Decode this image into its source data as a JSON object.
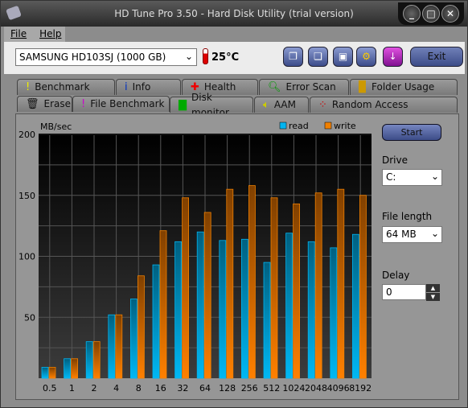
{
  "window": {
    "title": "HD Tune Pro 3.50 - Hard Disk Utility (trial version)",
    "minimize": "_",
    "maximize": "□",
    "close": "✕"
  },
  "menu": {
    "file": "File",
    "help": "Help"
  },
  "toolbar": {
    "drive": "SAMSUNG HD103SJ (1000 GB)",
    "temperature": "25°C",
    "exit": "Exit",
    "buttons": [
      "copy-text-icon",
      "copy-screenshot-icon",
      "save-icon",
      "options-icon",
      "download-icon"
    ]
  },
  "tabs": {
    "row1": [
      "Benchmark",
      "Info",
      "Health",
      "Error Scan",
      "Folder Usage"
    ],
    "row2": [
      "Erase",
      "File Benchmark",
      "Disk monitor",
      "AAM",
      "Random Access"
    ],
    "active": "File Benchmark"
  },
  "side": {
    "start": "Start",
    "drive_label": "Drive",
    "drive_value": "C:",
    "file_length_label": "File length",
    "file_length_value": "64 MB",
    "delay_label": "Delay",
    "delay_value": "0"
  },
  "chart_data": {
    "type": "bar",
    "ylabel": "MB/sec",
    "ylim": [
      0,
      200
    ],
    "yticks": [
      "200",
      "150",
      "100",
      "50"
    ],
    "categories": [
      "0.5",
      "1",
      "2",
      "4",
      "8",
      "16",
      "32",
      "64",
      "128",
      "256",
      "512",
      "1024",
      "2048",
      "4096",
      "8192"
    ],
    "series": [
      {
        "name": "read",
        "color": "#00b4f0",
        "values": [
          9,
          16,
          30,
          52,
          65,
          93,
          112,
          120,
          113,
          114,
          95,
          119,
          112,
          107,
          118
        ]
      },
      {
        "name": "write",
        "color": "#f08000",
        "values": [
          9,
          16,
          30,
          52,
          84,
          121,
          148,
          136,
          155,
          158,
          148,
          143,
          152,
          155,
          150
        ]
      }
    ],
    "grid": true,
    "legend": "top-right"
  }
}
